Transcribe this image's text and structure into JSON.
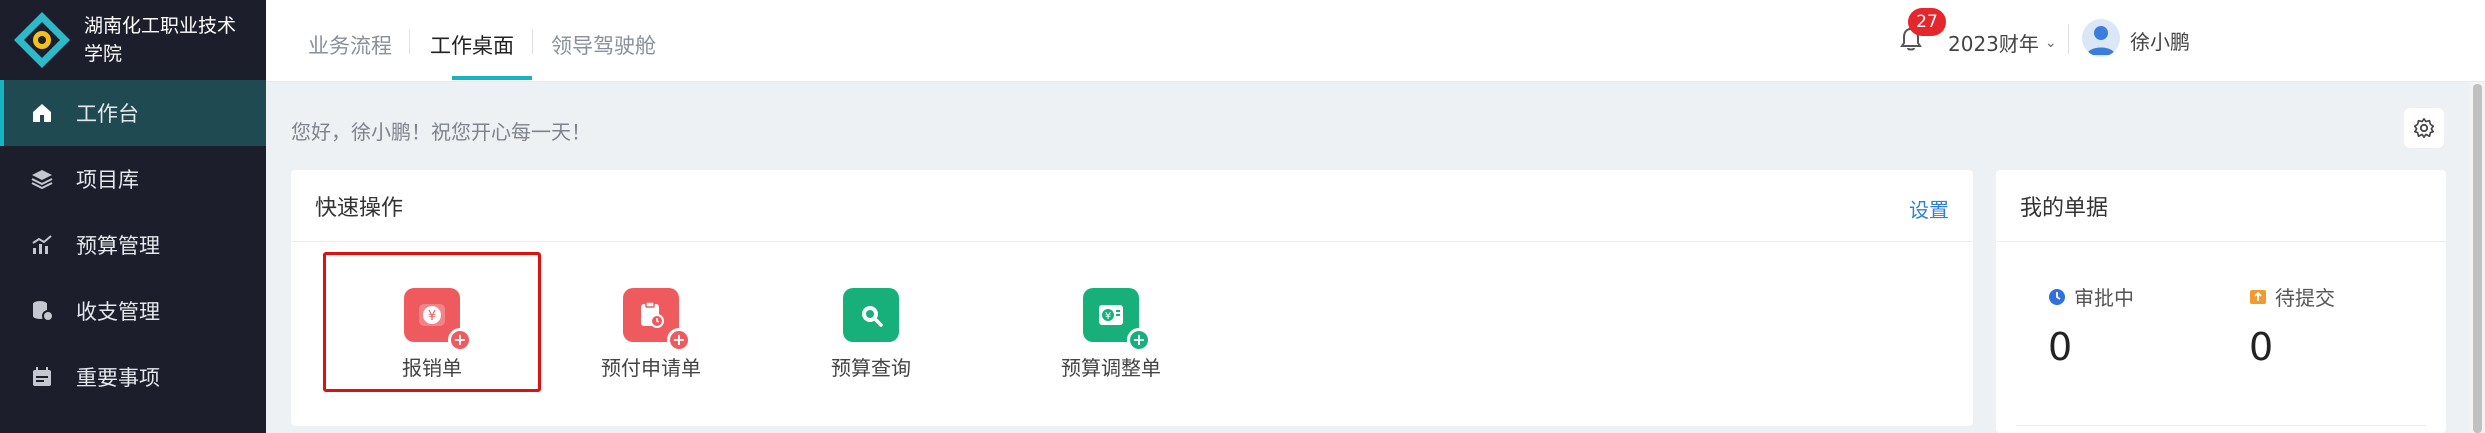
{
  "sidebar": {
    "brand": "湖南化工职业技术学院",
    "items": [
      {
        "label": "工作台",
        "icon": "home-icon",
        "active": true
      },
      {
        "label": "项目库",
        "icon": "layers-icon"
      },
      {
        "label": "预算管理",
        "icon": "chart-icon"
      },
      {
        "label": "收支管理",
        "icon": "coins-icon"
      },
      {
        "label": "重要事项",
        "icon": "calendar-icon"
      }
    ]
  },
  "topbar": {
    "tabs": [
      {
        "label": "业务流程"
      },
      {
        "label": "工作桌面",
        "active": true
      },
      {
        "label": "领导驾驶舱"
      }
    ],
    "notification_count": "27",
    "fiscal_year": "2023财年",
    "user": "徐小鹏"
  },
  "greeting": "您好，徐小鹏！祝您开心每一天！",
  "quick": {
    "title": "快速操作",
    "settings_label": "设置",
    "items": [
      {
        "label": "报销单",
        "icon": "reimbursement-icon",
        "color": "#ef5a5f"
      },
      {
        "label": "预付申请单",
        "icon": "prepayment-icon",
        "color": "#ef5a5f"
      },
      {
        "label": "预算查询",
        "icon": "budget-query-icon",
        "color": "#17b07b"
      },
      {
        "label": "预算调整单",
        "icon": "budget-adjust-icon",
        "color": "#17b07b"
      }
    ]
  },
  "mine": {
    "title": "我的单据",
    "stats": [
      {
        "label": "审批中",
        "value": "0",
        "color": "#2f6fde"
      },
      {
        "label": "待提交",
        "value": "0",
        "color": "#f29a2e"
      }
    ]
  },
  "colors": {
    "sidebar_bg": "#1c1e2b",
    "accent": "#17b3c3",
    "highlight": "#e01010",
    "link": "#2f80d8"
  }
}
